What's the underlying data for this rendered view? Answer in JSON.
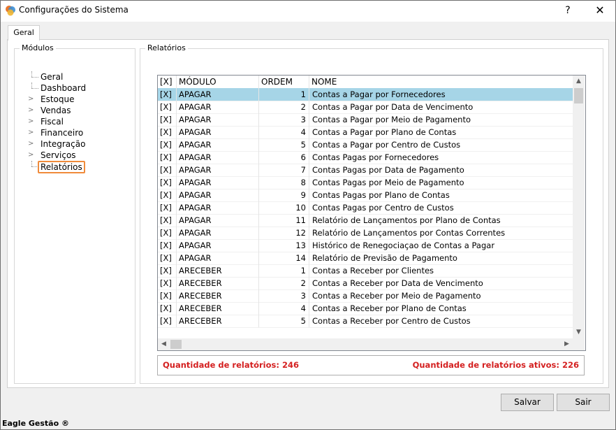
{
  "window": {
    "title": "Configurações do Sistema",
    "help_label": "?",
    "close_label": "✕"
  },
  "tabs": [
    {
      "label": "Geral"
    }
  ],
  "modules_group": {
    "title": "Módulos"
  },
  "tree": {
    "items": [
      {
        "label": "Geral",
        "expandable": false
      },
      {
        "label": "Dashboard",
        "expandable": false
      },
      {
        "label": "Estoque",
        "expandable": true
      },
      {
        "label": "Vendas",
        "expandable": true
      },
      {
        "label": "Fiscal",
        "expandable": true
      },
      {
        "label": "Financeiro",
        "expandable": true
      },
      {
        "label": "Integração",
        "expandable": true
      },
      {
        "label": "Serviços",
        "expandable": true
      },
      {
        "label": "Relatórios",
        "expandable": false,
        "selected": true
      }
    ]
  },
  "reports_group": {
    "title": "Relatórios"
  },
  "grid": {
    "columns": [
      "[X]",
      "MÓDULO",
      "ORDEM",
      "NOME"
    ],
    "rows": [
      {
        "check": "[X]",
        "modulo": "APAGAR",
        "ordem": "1",
        "nome": "Contas a Pagar por Fornecedores",
        "selected": true
      },
      {
        "check": "[X]",
        "modulo": "APAGAR",
        "ordem": "2",
        "nome": "Contas a Pagar por Data de Vencimento"
      },
      {
        "check": "[X]",
        "modulo": "APAGAR",
        "ordem": "3",
        "nome": "Contas a Pagar por Meio de Pagamento"
      },
      {
        "check": "[X]",
        "modulo": "APAGAR",
        "ordem": "4",
        "nome": "Contas a Pagar por Plano de Contas"
      },
      {
        "check": "[X]",
        "modulo": "APAGAR",
        "ordem": "5",
        "nome": "Contas a Pagar por Centro de Custos"
      },
      {
        "check": "[X]",
        "modulo": "APAGAR",
        "ordem": "6",
        "nome": "Contas Pagas por Fornecedores"
      },
      {
        "check": "[X]",
        "modulo": "APAGAR",
        "ordem": "7",
        "nome": "Contas Pagas por Data de Pagamento"
      },
      {
        "check": "[X]",
        "modulo": "APAGAR",
        "ordem": "8",
        "nome": "Contas Pagas por Meio de Pagamento"
      },
      {
        "check": "[X]",
        "modulo": "APAGAR",
        "ordem": "9",
        "nome": "Contas Pagas por Plano de Contas"
      },
      {
        "check": "[X]",
        "modulo": "APAGAR",
        "ordem": "10",
        "nome": "Contas Pagas por Centro de Custos"
      },
      {
        "check": "[X]",
        "modulo": "APAGAR",
        "ordem": "11",
        "nome": "Relatório de Lançamentos por Plano de Contas"
      },
      {
        "check": "[X]",
        "modulo": "APAGAR",
        "ordem": "12",
        "nome": "Relatório de Lançamentos por Contas Correntes"
      },
      {
        "check": "[X]",
        "modulo": "APAGAR",
        "ordem": "13",
        "nome": "Histórico de Renegociaçao de Contas a Pagar"
      },
      {
        "check": "[X]",
        "modulo": "APAGAR",
        "ordem": "14",
        "nome": "Relatório de Previsão de Pagamento"
      },
      {
        "check": "[X]",
        "modulo": "ARECEBER",
        "ordem": "1",
        "nome": "Contas a Receber por Clientes"
      },
      {
        "check": "[X]",
        "modulo": "ARECEBER",
        "ordem": "2",
        "nome": "Contas a Receber por Data de Vencimento"
      },
      {
        "check": "[X]",
        "modulo": "ARECEBER",
        "ordem": "3",
        "nome": "Contas a Receber por Meio de Pagamento"
      },
      {
        "check": "[X]",
        "modulo": "ARECEBER",
        "ordem": "4",
        "nome": "Contas a Receber por Plano de Contas"
      },
      {
        "check": "[X]",
        "modulo": "ARECEBER",
        "ordem": "5",
        "nome": "Contas a Receber por Centro de Custos"
      }
    ]
  },
  "status": {
    "total_label": "Quantidade de relatórios: 246",
    "active_label": "Quantidade de relatórios ativos: 226"
  },
  "buttons": {
    "save": "Salvar",
    "exit": "Sair"
  },
  "footer": {
    "text": "Eagle Gestão ®"
  },
  "colors": {
    "selected_row": "#a6d5e7",
    "status_text": "#d42020",
    "tree_highlight": "#f08b3b"
  }
}
